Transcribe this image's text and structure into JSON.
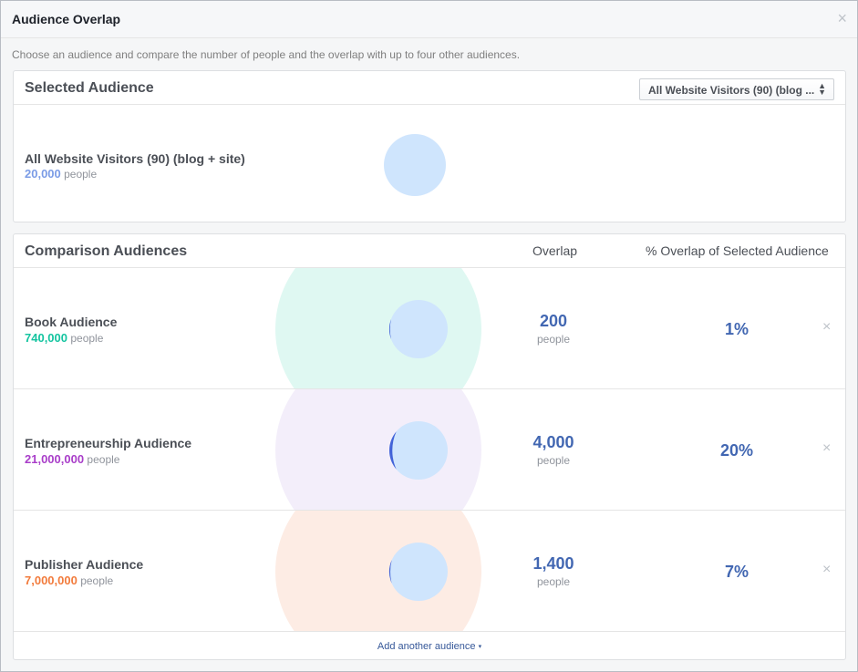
{
  "dialog": {
    "title": "Audience Overlap",
    "close_icon": "×",
    "intro": "Choose an audience and compare the number of people and the overlap with up to four other audiences."
  },
  "selected": {
    "heading": "Selected Audience",
    "dropdown_value": "All Website Visitors (90) (blog ...",
    "dropdown_icon": "⇕",
    "name": "All Website Visitors (90) (blog + site)",
    "size": "20,000",
    "size_unit": "people",
    "color": "#7b9ce6"
  },
  "comparison": {
    "heading": "Comparison Audiences",
    "col_overlap": "Overlap",
    "col_pct": "% Overlap of Selected Audience",
    "rows": [
      {
        "name": "Book Audience",
        "size": "740,000",
        "size_unit": "people",
        "size_color": "#14c4a0",
        "shape_color": "#dff8f2",
        "overlap": "200",
        "overlap_unit": "people",
        "pct": "1%",
        "overlap_fraction": 0.01,
        "remove_icon": "×"
      },
      {
        "name": "Entrepreneurship Audience",
        "size": "21,000,000",
        "size_unit": "people",
        "size_color": "#a93ec9",
        "shape_color": "#f3eefa",
        "overlap": "4,000",
        "overlap_unit": "people",
        "pct": "20%",
        "overlap_fraction": 0.2,
        "remove_icon": "×"
      },
      {
        "name": "Publisher Audience",
        "size": "7,000,000",
        "size_unit": "people",
        "size_color": "#f27b3c",
        "shape_color": "#fdece4",
        "overlap": "1,400",
        "overlap_unit": "people",
        "pct": "7%",
        "overlap_fraction": 0.07,
        "remove_icon": "×"
      }
    ],
    "add_link": "Add another audience",
    "add_caret": "▾"
  },
  "colors": {
    "overlap_blue": "#4267b2",
    "selected_circle": "#cfe5fd",
    "overlap_crescent": "#4263d8"
  }
}
